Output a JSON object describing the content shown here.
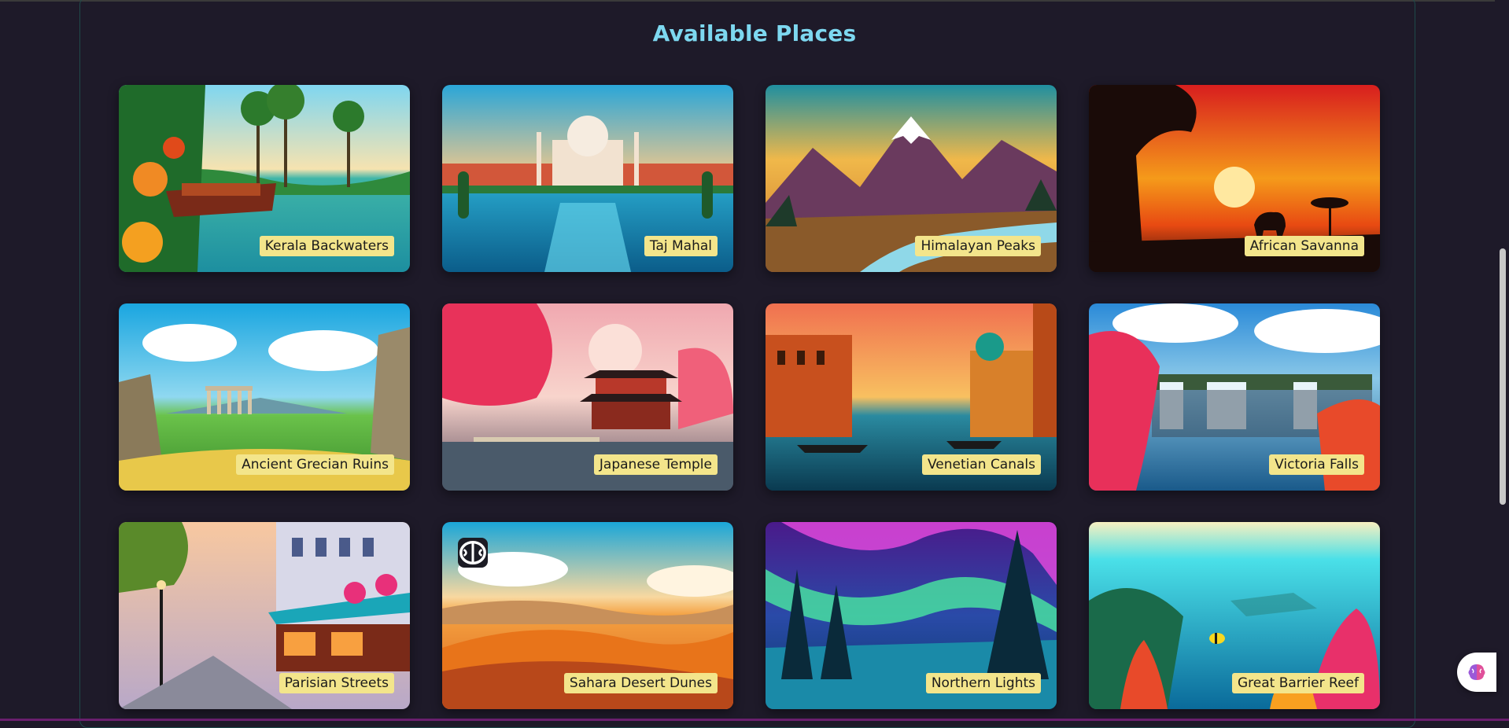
{
  "page": {
    "title": "Available Places"
  },
  "places": [
    {
      "label": "Kerala Backwaters",
      "icon": "kerala-scene"
    },
    {
      "label": "Taj Mahal",
      "icon": "taj-scene"
    },
    {
      "label": "Himalayan Peaks",
      "icon": "mountain-scene"
    },
    {
      "label": "African Savanna",
      "icon": "savanna-scene"
    },
    {
      "label": "Ancient Grecian Ruins",
      "icon": "ruins-scene"
    },
    {
      "label": "Japanese Temple",
      "icon": "temple-scene"
    },
    {
      "label": "Venetian Canals",
      "icon": "canal-scene"
    },
    {
      "label": "Victoria Falls",
      "icon": "waterfall-scene"
    },
    {
      "label": "Parisian Streets",
      "icon": "street-scene"
    },
    {
      "label": "Sahara Desert Dunes",
      "icon": "desert-scene"
    },
    {
      "label": "Northern Lights",
      "icon": "aurora-scene"
    },
    {
      "label": "Great Barrier Reef",
      "icon": "reef-scene"
    }
  ],
  "colors": {
    "title": "#7dd8f0",
    "background": "#1e1a29",
    "label_bg": "#f3e58b"
  }
}
